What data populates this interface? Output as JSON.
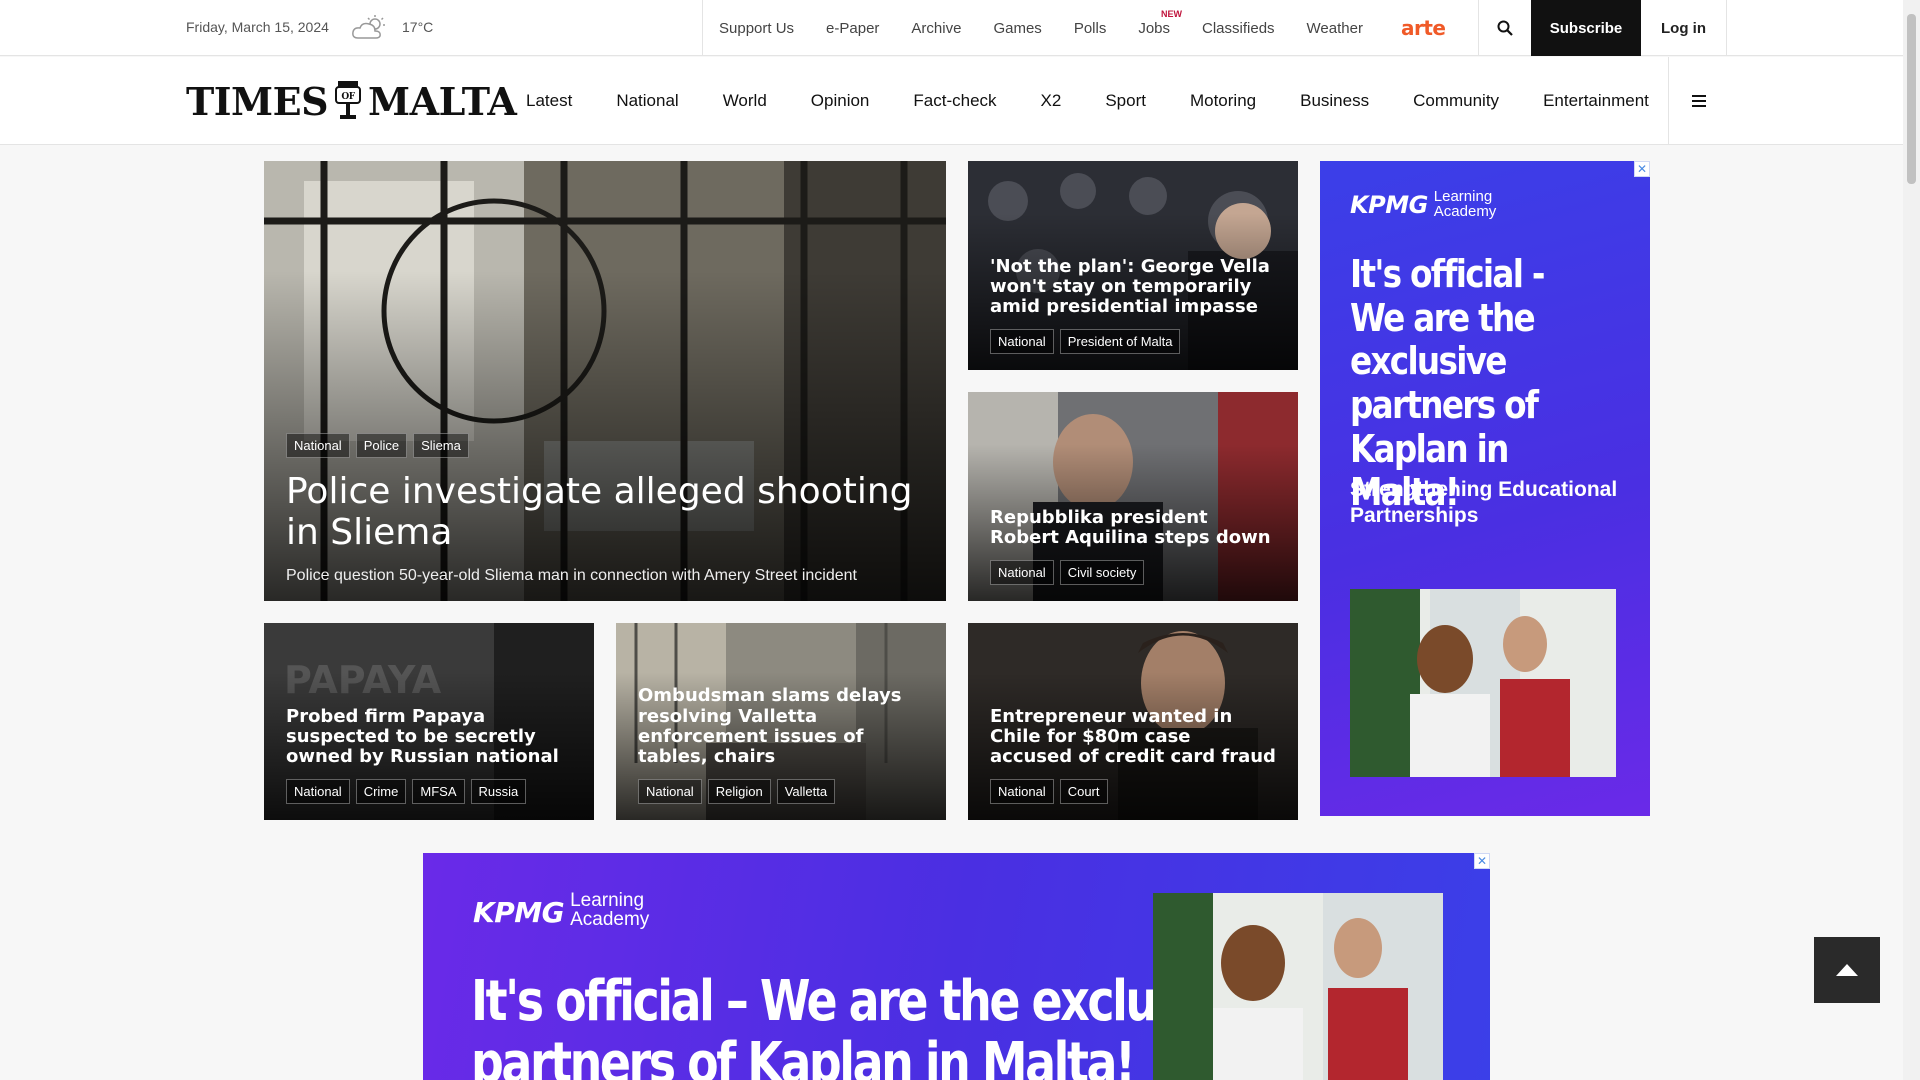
{
  "topbar": {
    "date": "Friday, March 15, 2024",
    "weather_icon": "cloud-sun-icon",
    "temperature": "17°C",
    "links": [
      {
        "label": "Support Us",
        "badge": ""
      },
      {
        "label": "e-Paper",
        "badge": ""
      },
      {
        "label": "Archive",
        "badge": ""
      },
      {
        "label": "Games",
        "badge": ""
      },
      {
        "label": "Polls",
        "badge": ""
      },
      {
        "label": "Jobs",
        "badge": "NEW"
      },
      {
        "label": "Classifieds",
        "badge": ""
      },
      {
        "label": "Weather",
        "badge": ""
      }
    ],
    "partner_logo": "arte",
    "search_icon": "search-icon",
    "subscribe_label": "Subscribe",
    "login_label": "Log in"
  },
  "logo": {
    "left": "TIMES",
    "right": "MALTA",
    "crest_text": "OF"
  },
  "nav": {
    "sections": [
      "Latest",
      "National",
      "World",
      "Opinion",
      "Fact-check",
      "X2",
      "Sport",
      "Motoring",
      "Business",
      "Community",
      "Entertainment"
    ],
    "menu_icon": "hamburger-menu-icon"
  },
  "hero": {
    "tags": [
      "National",
      "Police",
      "Sliema"
    ],
    "title": "Police investigate alleged shooting in Sliema",
    "standfirst": "Police question 50-year-old Sliema man in connection with Amery Street incident"
  },
  "side_articles": [
    {
      "title": "'Not the plan': George Vella won't stay on temporarily amid presidential impasse",
      "tags": [
        "National",
        "President of Malta"
      ]
    },
    {
      "title": "Repubblika president Robert Aquilina steps down",
      "tags": [
        "National",
        "Civil society"
      ]
    }
  ],
  "small_articles": [
    {
      "title": "Probed firm Papaya suspected to be secretly owned by Russian national",
      "tags": [
        "National",
        "Crime",
        "MFSA",
        "Russia"
      ]
    },
    {
      "title": "Ombudsman slams delays resolving Valletta enforcement issues of tables, chairs",
      "tags": [
        "National",
        "Religion",
        "Valletta"
      ]
    },
    {
      "title": "Entrepreneur wanted in Chile for $80m case accused of credit card fraud",
      "tags": [
        "National",
        "Court"
      ]
    }
  ],
  "ad_side": {
    "brand": "KPMG",
    "brand_sub_1": "Learning",
    "brand_sub_2": "Academy",
    "headline": "It's official - We are the exclusive partners of Kaplan in Malta!",
    "subline": "Strengthening Educational Partnerships",
    "close_icon": "close-icon"
  },
  "ad_banner": {
    "brand": "KPMG",
    "brand_sub_1": "Learning",
    "brand_sub_2": "Academy",
    "headline_line1": "It's official – We are the exclusive",
    "headline_line2": "partners of Kaplan in Malta!",
    "close_icon": "close-icon"
  },
  "back_to_top_icon": "arrow-up-icon",
  "colors": {
    "subscribe_bg": "#111111",
    "arte_orange": "#f05a28",
    "ad_blue": "#3b3fe8",
    "ad_purple": "#6a2ae8",
    "new_badge": "#c0143c"
  }
}
